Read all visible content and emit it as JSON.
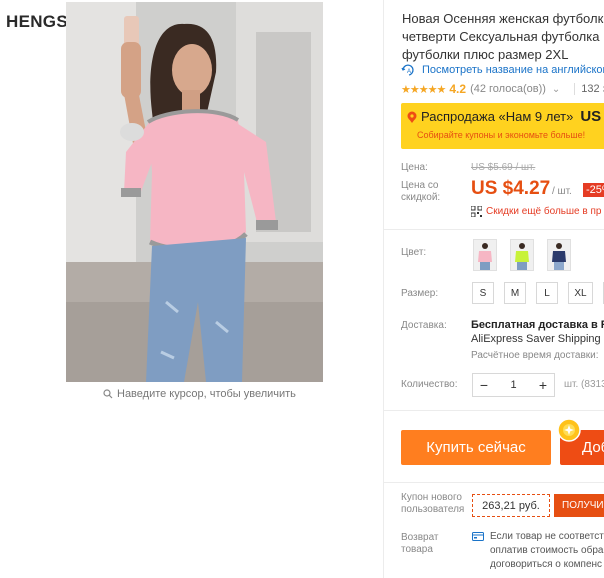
{
  "brand": {
    "logo_text": "HENGSON",
    "logo_accent": "G"
  },
  "gallery": {
    "zoom_hint": "Наведите курсор, чтобы увеличить"
  },
  "product": {
    "title_lines": [
      "Новая Осенняя женская футболка",
      "четверти Сексуальная футболка По",
      "футболки плюс размер 2XL"
    ],
    "translate_link": "Посмотреть название на английском",
    "rating": {
      "stars": 4,
      "value": "4.2",
      "votes": "(42 голоса(ов))",
      "orders": "132 з"
    }
  },
  "promo": {
    "title": "Распродажа «Нам 9 лет»",
    "badge": "US",
    "subtitle": "Собирайте купоны и экономьте больше!"
  },
  "price": {
    "label_price": "Цена:",
    "old": "US $5.69 / шт.",
    "label_discount": "Цена со скидкой:",
    "new": "US $4.27",
    "unit": "/ шт.",
    "discount": "-25%",
    "more_discount": "Скидки ещё больше в пр"
  },
  "options": {
    "color_label": "Цвет:",
    "size_label": "Размер:",
    "sizes": [
      "S",
      "M",
      "L",
      "XL"
    ]
  },
  "shipping": {
    "label": "Доставка:",
    "title": "Бесплатная доставка в Ru",
    "method": "AliExpress Saver Shipping",
    "time": "Расчётное время доставки:"
  },
  "quantity": {
    "label": "Количество:",
    "minus": "−",
    "value": "1",
    "plus": "+",
    "stock": "шт. (8313"
  },
  "actions": {
    "buy_now": "Купить сейчас",
    "add_to_cart": "Доба"
  },
  "coupon": {
    "label": "Купон нового пользователя",
    "amount": "263,21 руб.",
    "button": "ПОЛУЧИ"
  },
  "returns": {
    "label": "Возврат товара",
    "text_lines": [
      "Если товар не соответст",
      "оплатив стоимость обра",
      "договориться о компенс"
    ]
  },
  "colors": {
    "accent_orange": "#ff7e1f",
    "accent_red": "#e64f12",
    "promo_yellow": "#ffd21f",
    "link_blue": "#1a73c8",
    "star_gold": "#f5a623"
  }
}
